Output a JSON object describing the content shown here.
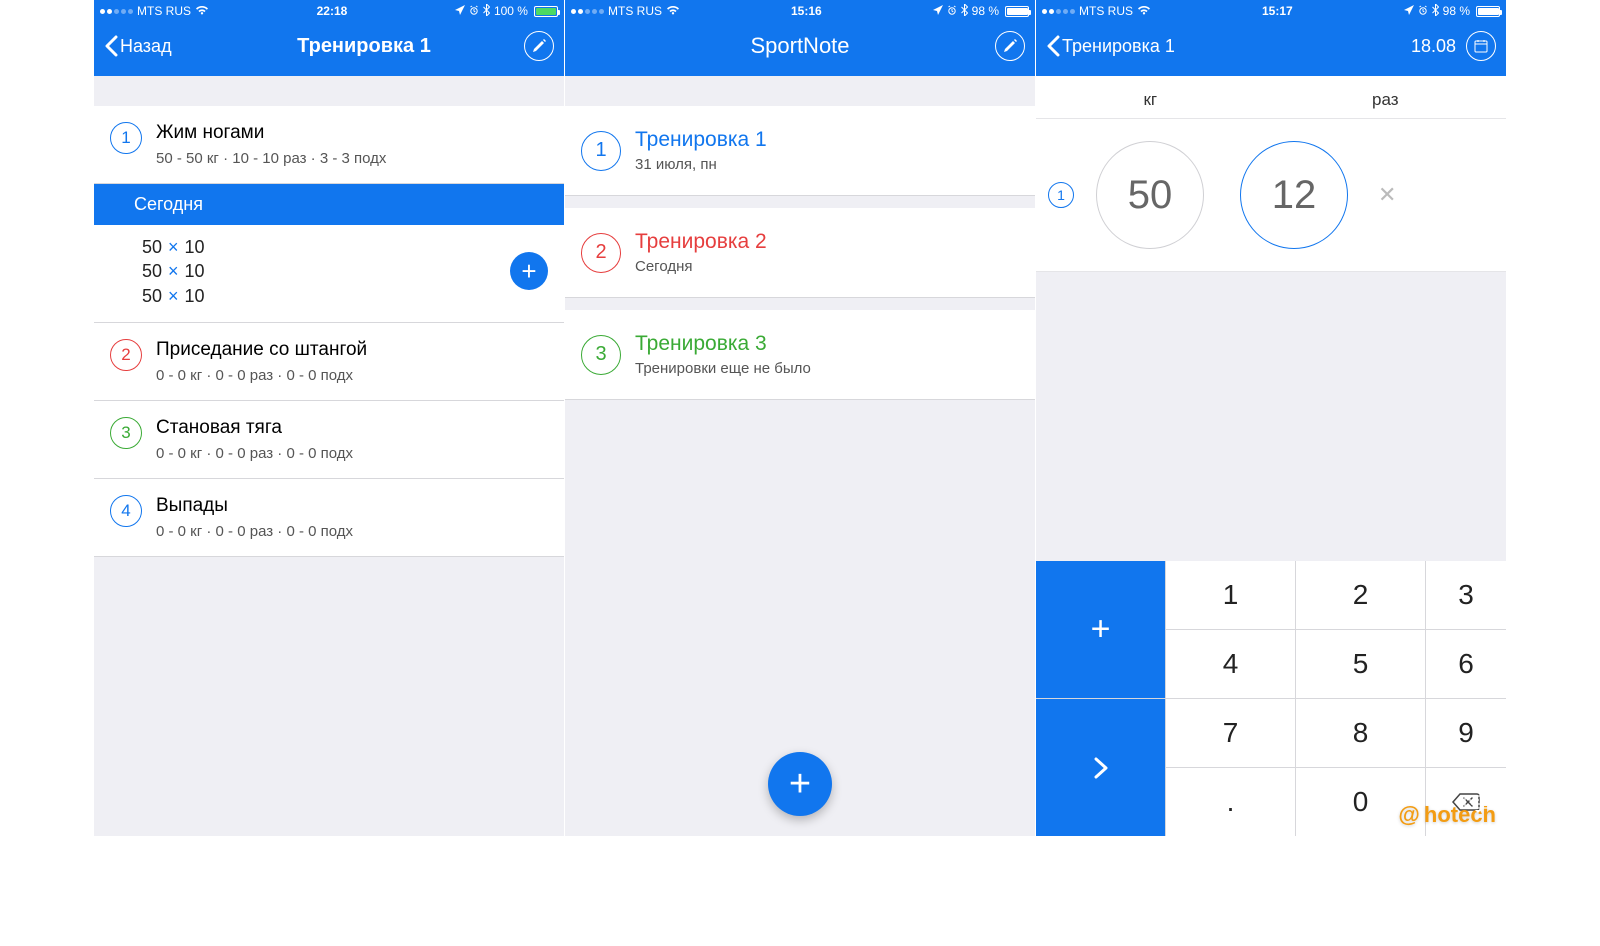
{
  "screen1": {
    "status": {
      "carrier": "MTS RUS",
      "time": "22:18",
      "battery_pct": "100 %",
      "battery_style": "green",
      "battery_fill": 100
    },
    "nav": {
      "back": "Назад",
      "title": "Тренировка 1"
    },
    "section": "Сегодня",
    "exercise1": {
      "num": "1",
      "title": "Жим ногами",
      "sub": "50 - 50 кг · 10 - 10 раз · 3 - 3 подх"
    },
    "sets": [
      {
        "w": "50",
        "r": "10"
      },
      {
        "w": "50",
        "r": "10"
      },
      {
        "w": "50",
        "r": "10"
      }
    ],
    "others": [
      {
        "num": "2",
        "color": "red",
        "title": "Приседание со штангой",
        "sub": "0 - 0 кг · 0 - 0 раз · 0 - 0 подх"
      },
      {
        "num": "3",
        "color": "green",
        "title": "Становая тяга",
        "sub": "0 - 0 кг · 0 - 0 раз · 0 - 0 подх"
      },
      {
        "num": "4",
        "color": "blue",
        "title": "Выпады",
        "sub": "0 - 0 кг · 0 - 0 раз · 0 - 0 подх"
      }
    ]
  },
  "screen2": {
    "status": {
      "carrier": "MTS RUS",
      "time": "15:16",
      "battery_pct": "98 %",
      "battery_style": "white",
      "battery_fill": 98
    },
    "nav": {
      "title": "SportNote"
    },
    "items": [
      {
        "num": "1",
        "color": "blue",
        "title": "Тренировка 1",
        "sub": "31 июля, пн"
      },
      {
        "num": "2",
        "color": "red",
        "title": "Тренировка 2",
        "sub": "Сегодня"
      },
      {
        "num": "3",
        "color": "green",
        "title": "Тренировка 3",
        "sub": "Тренировки еще не было"
      }
    ]
  },
  "screen3": {
    "status": {
      "carrier": "MTS RUS",
      "time": "15:17",
      "battery_pct": "98 %",
      "battery_style": "white",
      "battery_fill": 98
    },
    "nav": {
      "back": "Тренировка 1",
      "date": "18.08"
    },
    "unit_kg": "кг",
    "unit_reps": "раз",
    "set_num": "1",
    "kg": "50",
    "reps": "12",
    "keys": {
      "k1": "1",
      "k2": "2",
      "k3": "3",
      "k4": "4",
      "k5": "5",
      "k6": "6",
      "k7": "7",
      "k8": "8",
      "k9": "9",
      "k0": "0",
      "dot": "."
    }
  },
  "watermark": "hotech"
}
